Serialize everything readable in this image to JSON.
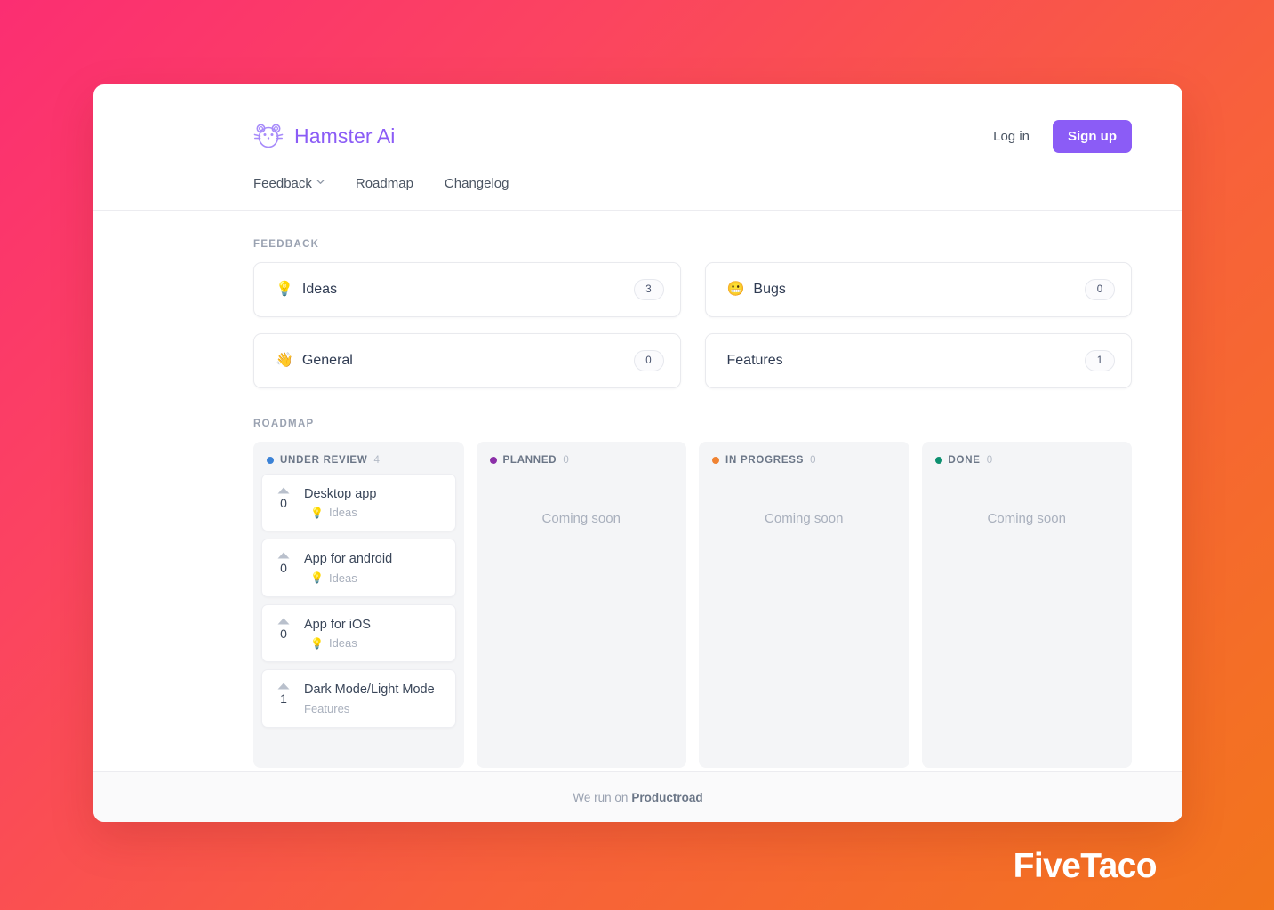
{
  "background": {
    "gradient_start": "#fb2e72",
    "gradient_end": "#f2751c"
  },
  "header": {
    "brand_name": "Hamster Ai",
    "brand_color": "#8b5cf6",
    "login_label": "Log in",
    "signup_label": "Sign up",
    "signup_color": "#8b5cf6",
    "nav": [
      {
        "label": "Feedback",
        "has_chevron": true
      },
      {
        "label": "Roadmap",
        "has_chevron": false
      },
      {
        "label": "Changelog",
        "has_chevron": false
      }
    ]
  },
  "feedback": {
    "section_title": "FEEDBACK",
    "cards": [
      {
        "emoji": "💡",
        "label": "Ideas",
        "count": "3"
      },
      {
        "emoji": "😬",
        "label": "Bugs",
        "count": "0"
      },
      {
        "emoji": "👋",
        "label": "General",
        "count": "0"
      },
      {
        "emoji": "",
        "label": "Features",
        "count": "1"
      }
    ]
  },
  "roadmap": {
    "section_title": "ROADMAP",
    "coming_soon_label": "Coming soon",
    "columns": [
      {
        "name": "UNDER REVIEW",
        "count": "4",
        "dot_color": "#3b82d6",
        "cards": [
          {
            "votes": "0",
            "title": "Desktop app",
            "category": "Ideas",
            "category_emoji": "💡"
          },
          {
            "votes": "0",
            "title": "App for android",
            "category": "Ideas",
            "category_emoji": "💡"
          },
          {
            "votes": "0",
            "title": "App for iOS",
            "category": "Ideas",
            "category_emoji": "💡"
          },
          {
            "votes": "1",
            "title": "Dark Mode/Light Mode",
            "category": "Features",
            "category_emoji": ""
          }
        ]
      },
      {
        "name": "PLANNED",
        "count": "0",
        "dot_color": "#8b2fa8",
        "cards": []
      },
      {
        "name": "IN PROGRESS",
        "count": "0",
        "dot_color": "#f08332",
        "cards": []
      },
      {
        "name": "DONE",
        "count": "0",
        "dot_color": "#0d9070",
        "cards": []
      }
    ]
  },
  "footer": {
    "prefix": "We run on",
    "brand": "Productroad"
  },
  "watermark": {
    "text": "FiveTaco"
  }
}
